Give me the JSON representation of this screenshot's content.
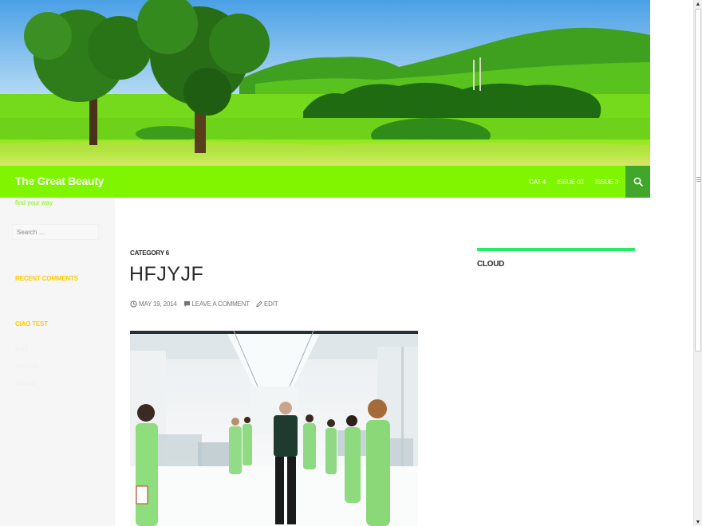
{
  "site": {
    "title": "The Great Beauty",
    "tagline": "find your way"
  },
  "nav": {
    "items": [
      {
        "label": "CAT 4"
      },
      {
        "label": "ISSUE 02"
      },
      {
        "label": "ISSUE 3"
      }
    ],
    "search_icon": "search-icon"
  },
  "sidebar": {
    "search_placeholder": "Search …",
    "widgets": [
      {
        "title": "RECENT COMMENTS",
        "links": []
      },
      {
        "title": "CIAO TEST",
        "links": [
          "Pinit",
          "contacts",
          "contact"
        ]
      }
    ]
  },
  "post": {
    "category": "CATEGORY 6",
    "title": "HFJYJF",
    "date": "MAY 19, 2014",
    "comment_label": "LEAVE A COMMENT",
    "edit_label": "EDIT",
    "icons": [
      "clock-icon",
      "comment-icon",
      "pencil-icon"
    ]
  },
  "right_sidebar": {
    "widget_title": "CLOUD"
  },
  "colors": {
    "accent_green": "#7ff500",
    "search_green": "#41a62a",
    "widget_title_yellow": "#ffcc00",
    "cloud_bar": "#24ee66"
  }
}
